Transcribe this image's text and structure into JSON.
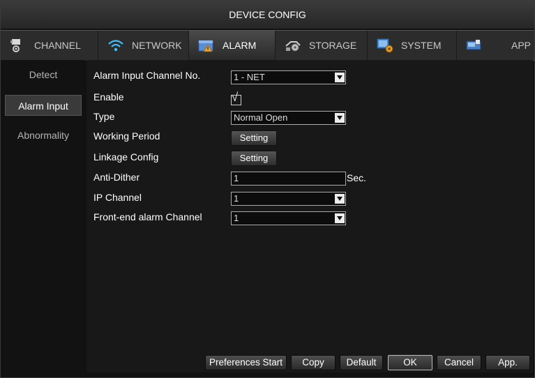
{
  "window": {
    "title": "DEVICE CONFIG"
  },
  "tabs": [
    {
      "label": "CHANNEL",
      "icon": "camera-icon"
    },
    {
      "label": "NETWORK",
      "icon": "wifi-icon"
    },
    {
      "label": "ALARM",
      "icon": "alarm-icon",
      "active": true
    },
    {
      "label": "STORAGE",
      "icon": "storage-icon"
    },
    {
      "label": "SYSTEM",
      "icon": "system-icon"
    },
    {
      "label": "APP",
      "icon": "app-icon"
    }
  ],
  "sidebar": {
    "items": [
      {
        "label": "Detect"
      },
      {
        "label": "Alarm Input",
        "active": true
      },
      {
        "label": "Abnormality"
      }
    ]
  },
  "form": {
    "alarm_input_channel": {
      "label": "Alarm Input Channel No.",
      "value": "1 - NET"
    },
    "enable": {
      "label": "Enable",
      "checked": true,
      "check_glyph": "√"
    },
    "type": {
      "label": "Type",
      "value": "Normal Open"
    },
    "working_period": {
      "label": "Working Period",
      "button": "Setting"
    },
    "linkage_config": {
      "label": "Linkage Config",
      "button": "Setting"
    },
    "anti_dither": {
      "label": "Anti-Dither",
      "value": "1",
      "unit": "Sec."
    },
    "ip_channel": {
      "label": "IP Channel",
      "value": "1"
    },
    "frontend_alarm_channel": {
      "label": "Front-end alarm Channel",
      "value": "1"
    }
  },
  "footer": {
    "preferences_start": "Preferences Start",
    "copy": "Copy",
    "default": "Default",
    "ok": "OK",
    "cancel": "Cancel",
    "apply": "App."
  },
  "colors": {
    "background": "#111111",
    "panel": "#181818",
    "text": "#ffffff",
    "active_tab": "#3a3a3a"
  }
}
